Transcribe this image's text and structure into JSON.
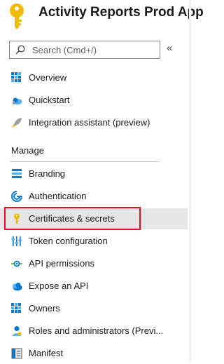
{
  "header": {
    "title": "Activity Reports Prod App",
    "icon": "key-icon"
  },
  "search": {
    "placeholder": "Search (Cmd+/)",
    "collapse_glyph": "«"
  },
  "nav": {
    "top_items": [
      {
        "label": "Overview",
        "icon": "overview-grid-icon"
      },
      {
        "label": "Quickstart",
        "icon": "cloud-quickstart-icon"
      },
      {
        "label": "Integration assistant (preview)",
        "icon": "rocket-icon"
      }
    ],
    "section_label": "Manage",
    "manage_items": [
      {
        "label": "Branding",
        "icon": "branding-icon"
      },
      {
        "label": "Authentication",
        "icon": "authentication-icon"
      },
      {
        "label": "Certificates & secrets",
        "icon": "key-icon",
        "selected": true
      },
      {
        "label": "Token configuration",
        "icon": "token-configuration-icon"
      },
      {
        "label": "API permissions",
        "icon": "api-permissions-icon"
      },
      {
        "label": "Expose an API",
        "icon": "cloud-expose-icon"
      },
      {
        "label": "Owners",
        "icon": "owners-grid-icon"
      },
      {
        "label": "Roles and administrators (Previ...",
        "icon": "roles-icon"
      },
      {
        "label": "Manifest",
        "icon": "manifest-icon"
      }
    ]
  },
  "colors": {
    "key_gold": "#f2b900",
    "accent_blue": "#0078d4",
    "selected_bg": "#e6e6e6",
    "highlight_red": "#e81123"
  }
}
